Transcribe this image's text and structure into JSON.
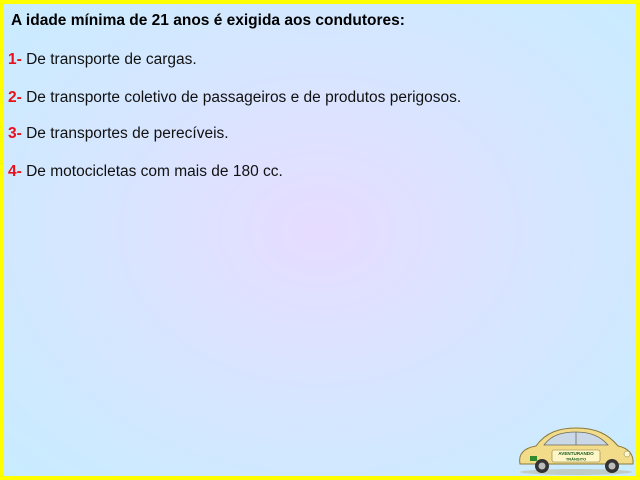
{
  "question": "A idade mínima de 21 anos é exigida aos condutores:",
  "options": [
    {
      "number": "1-",
      "text": "De transporte de cargas."
    },
    {
      "number": "2-",
      "text": "De transporte coletivo de passageiros e de produtos perigosos."
    },
    {
      "number": "3-",
      "text": "De transportes de perecíveis."
    },
    {
      "number": "4-",
      "text": "De motocicletas com mais de 180 cc."
    }
  ],
  "logo": {
    "line1": "AVENTURANDO",
    "line2": "TRÂNSITO"
  },
  "colors": {
    "border": "#ffff00",
    "number": "#e8101a",
    "car_body": "#f2dc8a"
  }
}
